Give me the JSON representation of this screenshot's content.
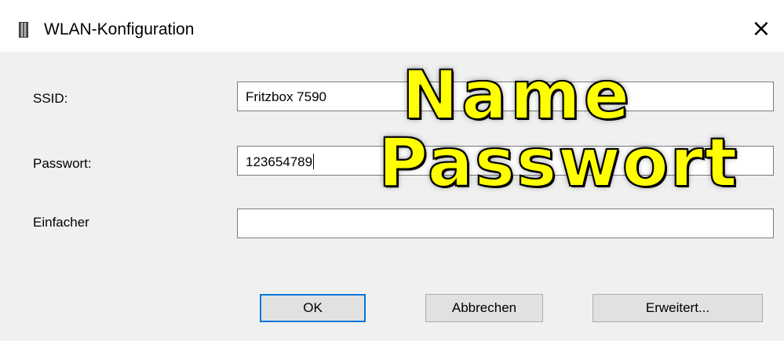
{
  "window": {
    "title": "WLAN-Konfiguration",
    "close_symbol": "×",
    "app_icon": "ssid-config-icon"
  },
  "form": {
    "ssid_label": "SSID:",
    "ssid_value": "Fritzbox 7590",
    "password_label": "Passwort:",
    "password_value": "123654789",
    "simple_label": "Einfacher",
    "simple_value": ""
  },
  "buttons": {
    "ok": "OK",
    "cancel": "Abbrechen",
    "advanced": "Erweitert..."
  },
  "overlay": {
    "line1": "Name",
    "line2": "Passwort",
    "color": "#ffff00"
  }
}
